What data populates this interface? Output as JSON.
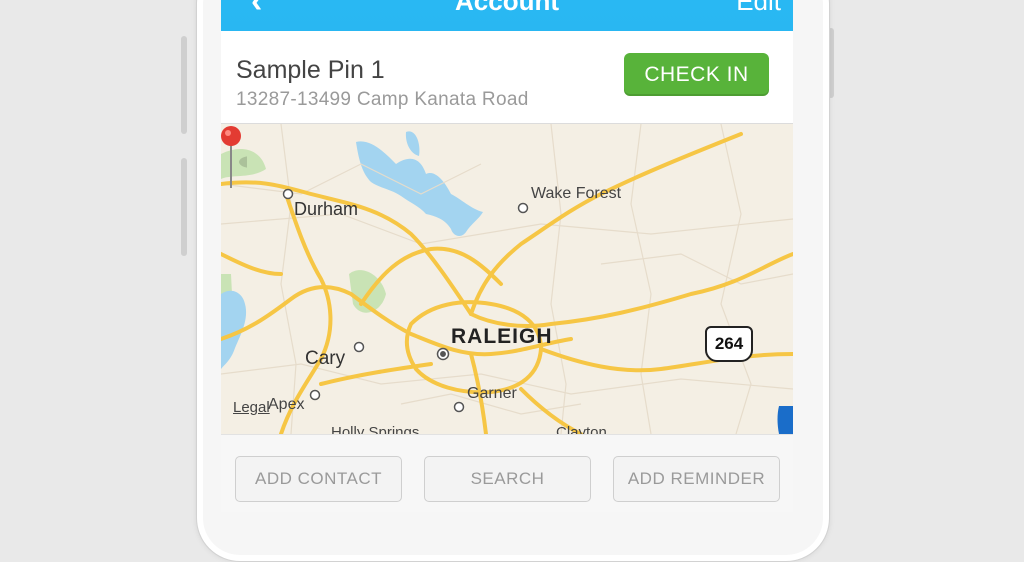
{
  "nav": {
    "back_glyph": "‹",
    "title": "Account",
    "edit_label": "Edit"
  },
  "pin": {
    "name": "Sample Pin 1",
    "address": "13287-13499 Camp Kanata Road",
    "check_in_label": "CHECK IN"
  },
  "map": {
    "labels": {
      "durham": "Durham",
      "wake_forest": "Wake Forest",
      "raleigh": "RALEIGH",
      "cary": "Cary",
      "garner": "Garner",
      "apex": "Apex",
      "legal": "Legal",
      "holly_springs": "Holly Springs",
      "clayton": "Clayton"
    },
    "highway_shield": "264"
  },
  "toolbar": {
    "add_contact": "ADD CONTACT",
    "search": "SEARCH",
    "add_reminder": "ADD REMINDER"
  },
  "colors": {
    "nav_bar": "#29b8f3",
    "check_in": "#58b33a",
    "road": "#f7c948",
    "water": "#a3d4f0",
    "park": "#c9e3b5",
    "pin": "#e33b32"
  }
}
